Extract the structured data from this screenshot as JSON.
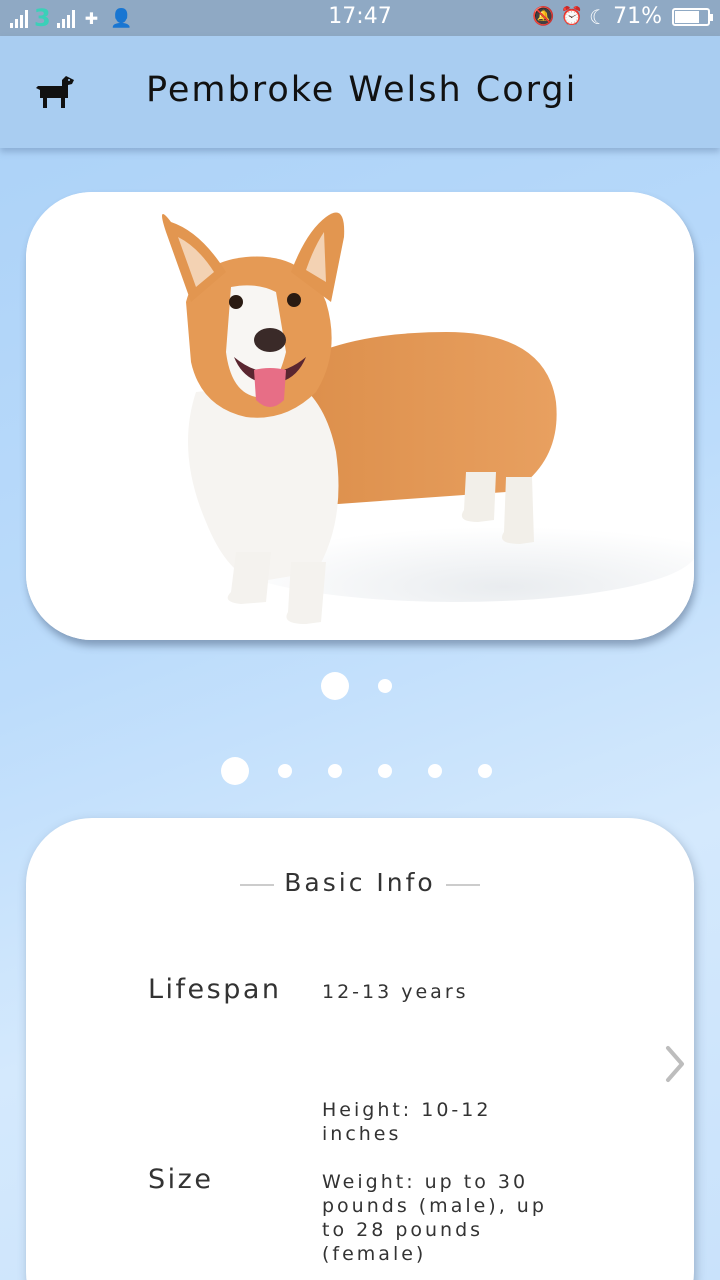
{
  "status_bar": {
    "carrier": "3",
    "time": "17:47",
    "battery": "71%",
    "battery_level": 0.71
  },
  "app_bar": {
    "icon": "dog-icon",
    "title": "Pembroke Welsh Corgi"
  },
  "gallery": {
    "image": "corgi-photo",
    "pages": 2,
    "current_page": 1
  },
  "info_pager": {
    "pages": 6,
    "current_page": 1
  },
  "basic_info": {
    "title": "Basic Info",
    "lifespan_label": "Lifespan",
    "lifespan_value": "12-13 years",
    "size_label": "Size",
    "height_value": "Height: 10-12 inches",
    "weight_value": "Weight: up to 30 pounds (male), up to 28 pounds (female)",
    "next_icon": "chevron-right-icon"
  }
}
